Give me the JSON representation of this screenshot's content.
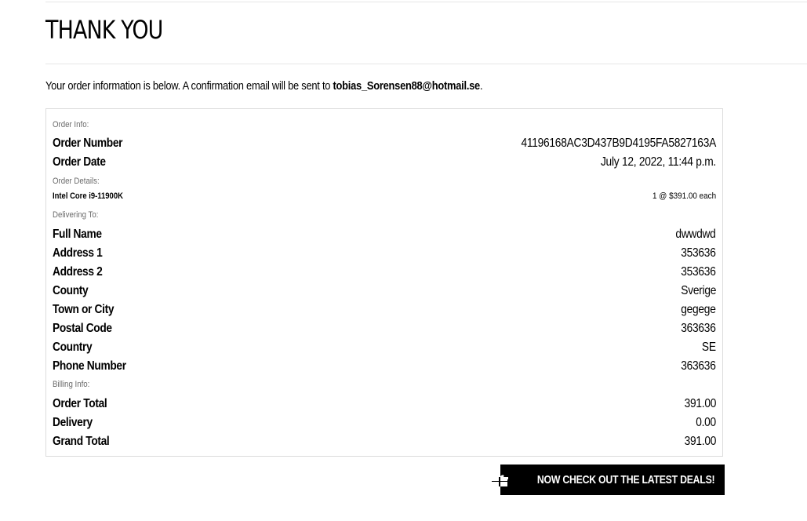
{
  "title": "THANK YOU",
  "intro": {
    "text": "Your order information is below. A confirmation email will be sent to ",
    "email": "tobias_Sorensen88@hotmail.se",
    "suffix": "."
  },
  "order_info": {
    "section_label": "Order Info:",
    "rows": [
      {
        "label": "Order Number",
        "value": "41196168AC3D437B9D4195FA5827163A"
      },
      {
        "label": "Order Date",
        "value": "July 12, 2022, 11:44 p.m."
      }
    ]
  },
  "order_details": {
    "section_label": "Order Details:",
    "items": [
      {
        "product": "Intel Core i9-11900K",
        "quantity_price": "1 @ $391.00 each"
      }
    ]
  },
  "delivering_to": {
    "section_label": "Delivering To:",
    "rows": [
      {
        "label": "Full Name",
        "value": "dwwdwd"
      },
      {
        "label": "Address 1",
        "value": "353636"
      },
      {
        "label": "Address 2",
        "value": "353636"
      },
      {
        "label": "County",
        "value": "Sverige"
      },
      {
        "label": "Town or City",
        "value": "gegege"
      },
      {
        "label": "Postal Code",
        "value": "363636"
      },
      {
        "label": "Country",
        "value": "SE"
      },
      {
        "label": "Phone Number",
        "value": "363636"
      }
    ]
  },
  "billing_info": {
    "section_label": "Billing Info:",
    "rows": [
      {
        "label": "Order Total",
        "value": "391.00"
      },
      {
        "label": "Delivery",
        "value": "0.00"
      },
      {
        "label": "Grand Total",
        "value": "391.00"
      }
    ]
  },
  "deals_button": {
    "label": "NOW CHECK OUT THE LATEST DEALS!",
    "icon": "gift-icon"
  }
}
